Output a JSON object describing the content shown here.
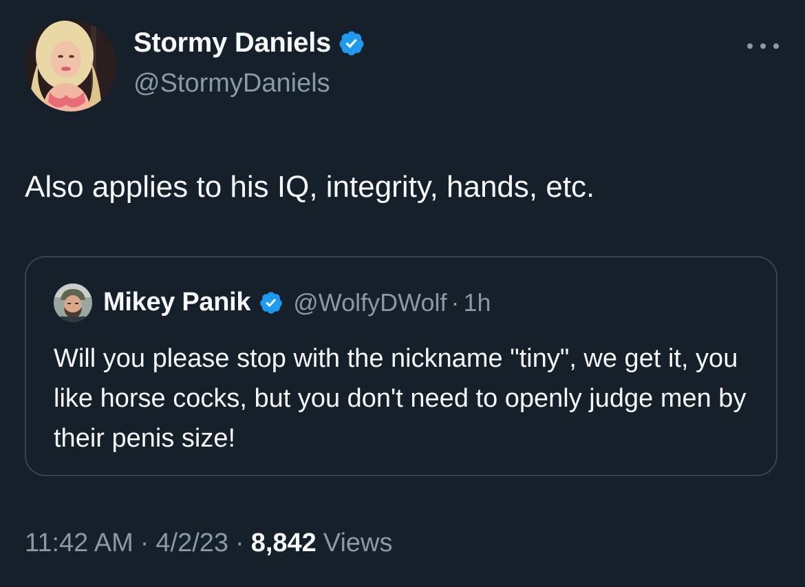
{
  "tweet": {
    "author": {
      "name": "Stormy Daniels",
      "handle": "@StormyDaniels",
      "verified": true
    },
    "text": "Also applies to his IQ, integrity, hands, etc.",
    "quoted": {
      "author": {
        "name": "Mikey Panik",
        "handle": "@WolfyDWolf",
        "verified": true
      },
      "separator": "·",
      "time": "1h",
      "text": "Will you please stop with the nickname \"tiny\", we get it,  you like horse cocks, but you don't need to openly judge men by their penis size!"
    },
    "meta": {
      "time": "11:42 AM",
      "date": "4/2/23",
      "separator": "·",
      "views_count": "8,842",
      "views_label": "Views"
    }
  },
  "colors": {
    "background": "#15202b",
    "text_primary": "#f7f9f9",
    "text_secondary": "#8b98a5",
    "border": "#38444d",
    "verified": "#1d9bf0"
  },
  "icons": {
    "verified": "verified-badge-icon",
    "more": "more-horizontal-icon"
  }
}
